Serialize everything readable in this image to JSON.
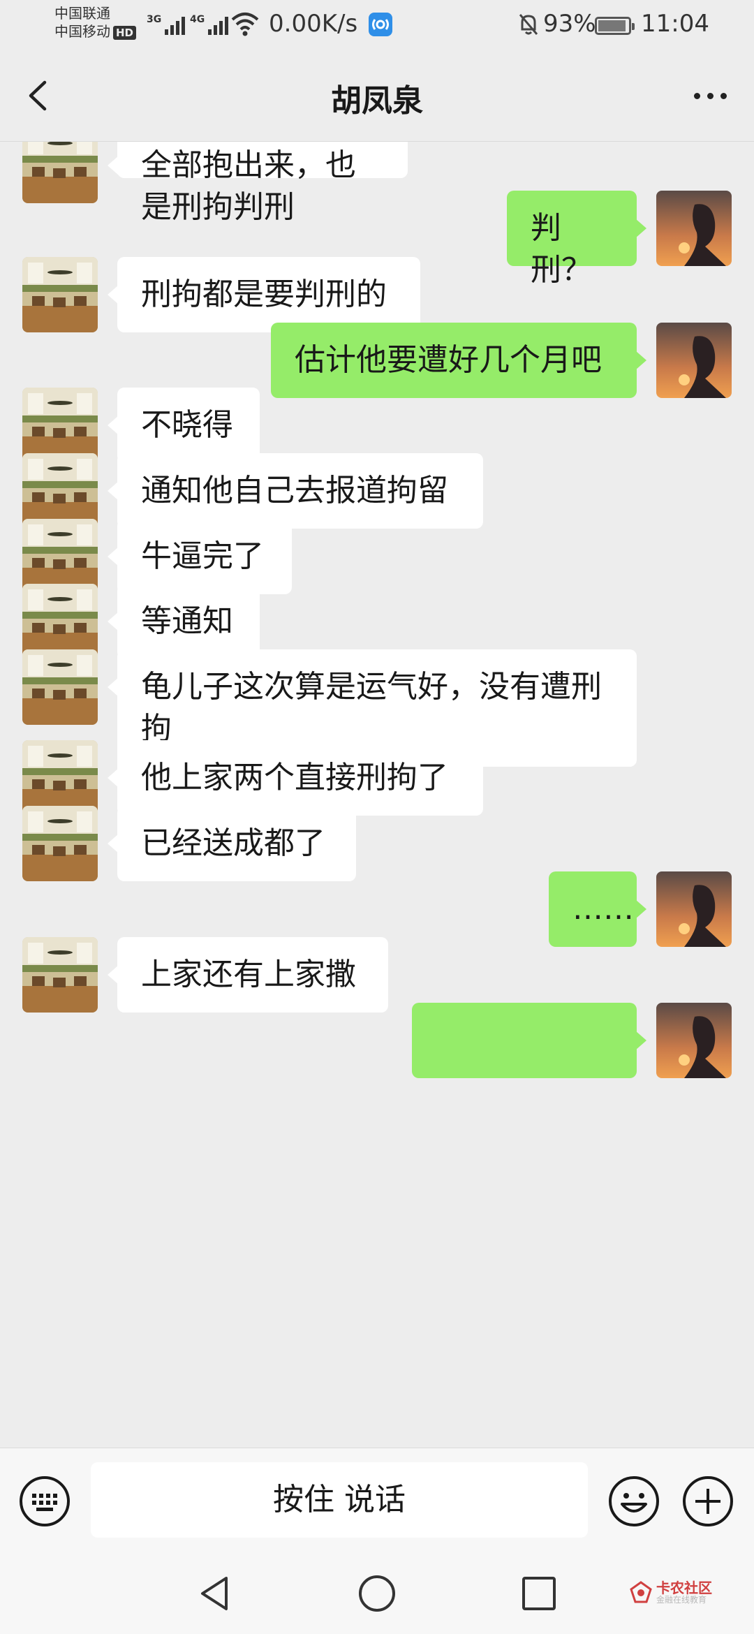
{
  "status_bar": {
    "carrier_1": "中国联通",
    "carrier_2": "中国移动",
    "hd_badge": "HD",
    "net_1": "3G",
    "net_2": "4G",
    "speed": "0.00K/s",
    "battery": "93%",
    "battery_level": 0.93,
    "time": "11:04"
  },
  "header": {
    "title": "胡凤泉",
    "back_icon": "chevron-left-icon",
    "more_icon": "more-dots-icon"
  },
  "messages": [
    {
      "dir": "in",
      "text": "全部抱出来，也是刑拘判刑"
    },
    {
      "dir": "out",
      "text": "判刑？"
    },
    {
      "dir": "in",
      "text": "刑拘都是要判刑的"
    },
    {
      "dir": "out",
      "text": "估计他要遭好几个月吧"
    },
    {
      "dir": "in",
      "text": "不晓得"
    },
    {
      "dir": "in",
      "text": "通知他自己去报道拘留"
    },
    {
      "dir": "in",
      "text": "牛逼完了"
    },
    {
      "dir": "in",
      "text": "等通知"
    },
    {
      "dir": "in",
      "text": "龟儿子这次算是运气好，没有遭刑拘"
    },
    {
      "dir": "in",
      "text": "他上家两个直接刑拘了"
    },
    {
      "dir": "in",
      "text": "已经送成都了"
    },
    {
      "dir": "out",
      "text": "……"
    },
    {
      "dir": "in",
      "text": "上家还有上家撒"
    },
    {
      "dir": "out",
      "text": ""
    }
  ],
  "input_bar": {
    "voice_label": "按住 说话",
    "keyboard_icon": "keyboard-icon",
    "emoji_icon": "emoji-icon",
    "plus_icon": "plus-icon"
  },
  "system_nav": {
    "back_icon": "triangle-back-icon",
    "home_icon": "circle-home-icon",
    "recents_icon": "square-recents-icon"
  },
  "watermark": {
    "name": "卡农社区",
    "sub": "金融在线教育"
  },
  "colors": {
    "background": "#ededed",
    "outgoing_bubble": "#95ec69",
    "incoming_bubble": "#ffffff"
  }
}
